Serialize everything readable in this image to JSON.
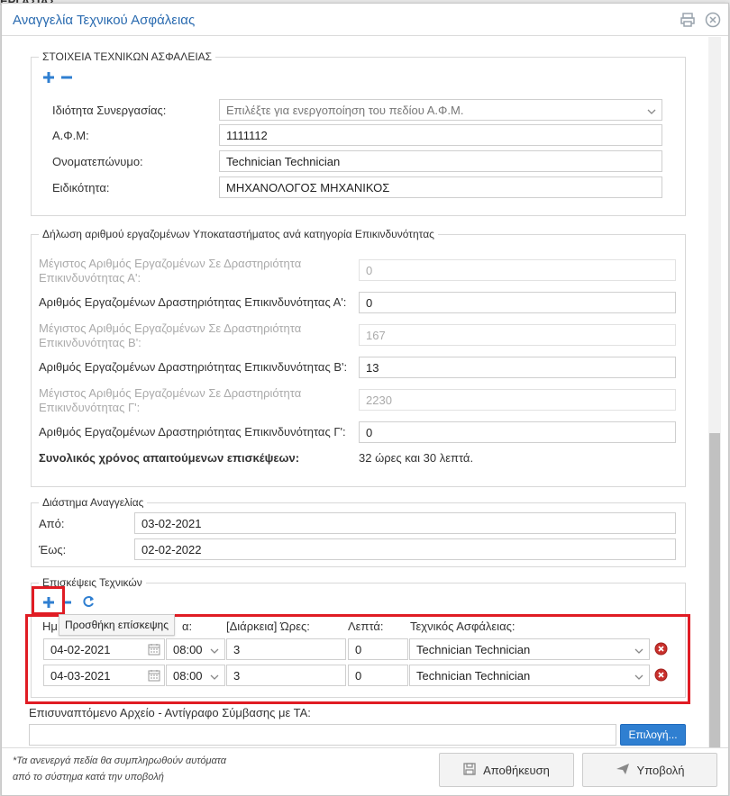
{
  "background_text": "ΕΡΓΑΣΙΑΣ",
  "dialog": {
    "title": "Αναγγελία Τεχνικού Ασφάλειας"
  },
  "technicians_section": {
    "legend": "ΣΤΟΙΧΕΙΑ ΤΕΧΝΙΚΩΝ ΑΣΦΑΛΕΙΑΣ",
    "fields": {
      "cooperation_label": "Ιδιότητα Συνεργασίας:",
      "cooperation_value": "Επιλέξτε για ενεργοποίηση του πεδίου Α.Φ.Μ.",
      "afm_label": "Α.Φ.Μ:",
      "afm_value": "1111112",
      "fullname_label": "Ονοματεπώνυμο:",
      "fullname_value": "Technician Technician",
      "specialty_label": "Ειδικότητα:",
      "specialty_value": "ΜΗΧΑΝΟΛΟΓΟΣ ΜΗΧΑΝΙΚΟΣ"
    }
  },
  "employees_section": {
    "legend": "Δήλωση αριθμού εργαζομένων Υποκαταστήματος ανά κατηγορία Επικινδυνότητας",
    "max_a_label": "Μέγιστος Αριθμός Εργαζομένων Σε Δραστηριότητα Επικινδυνότητας Α':",
    "max_a_value": "0",
    "num_a_label": "Αριθμός Εργαζομένων Δραστηριότητας Επικινδυνότητας Α':",
    "num_a_value": "0",
    "max_b_label": "Μέγιστος Αριθμός Εργαζομένων Σε Δραστηριότητα Επικινδυνότητας Β':",
    "max_b_value": "167",
    "num_b_label": "Αριθμός Εργαζομένων Δραστηριότητας Επικινδυνότητας Β':",
    "num_b_value": "13",
    "max_c_label": "Μέγιστος Αριθμός Εργαζομένων Σε Δραστηριότητα Επικινδυνότητας Γ':",
    "max_c_value": "2230",
    "num_c_label": "Αριθμός Εργαζομένων Δραστηριότητας Επικινδυνότητας Γ':",
    "num_c_value": "0",
    "total_label": "Συνολικός χρόνος απαιτούμενων επισκέψεων:",
    "total_value": "32 ώρες και 30 λεπτά."
  },
  "period_section": {
    "legend": "Διάστημα Αναγγελίας",
    "from_label": "Από:",
    "from_value": "03-02-2021",
    "to_label": "Έως:",
    "to_value": "02-02-2022"
  },
  "visits_section": {
    "legend": "Επισκέψεις Τεχνικών",
    "tooltip": "Προσθήκη επίσκεψης",
    "col_date_partial": "Ημ",
    "col_time_partial": "α:",
    "col_hours": "[Διάρκεια] Ώρες:",
    "col_minutes": "Λεπτά:",
    "col_technician": "Τεχνικός Ασφάλειας:",
    "rows": [
      {
        "date": "04-02-2021",
        "time": "08:00",
        "hours": "3",
        "minutes": "0",
        "technician": "Technician Technician"
      },
      {
        "date": "04-03-2021",
        "time": "08:00",
        "hours": "3",
        "minutes": "0",
        "technician": "Technician Technician"
      }
    ]
  },
  "attachment": {
    "label": "Επισυναπτόμενο Αρχείο - Αντίγραφο Σύμβασης με ΤΑ:",
    "button": "Επιλογή..."
  },
  "footer": {
    "note_line1": "*Τα ανενεργά πεδία θα συμπληρωθούν αυτόματα",
    "note_line2": "από το σύστημα κατά την υποβολή",
    "save_button": "Αποθήκευση",
    "submit_button": "Υποβολή"
  },
  "colors": {
    "accent": "#2a6bb0",
    "highlight_box": "#e01c24",
    "delete_icon": "#c9302c"
  }
}
